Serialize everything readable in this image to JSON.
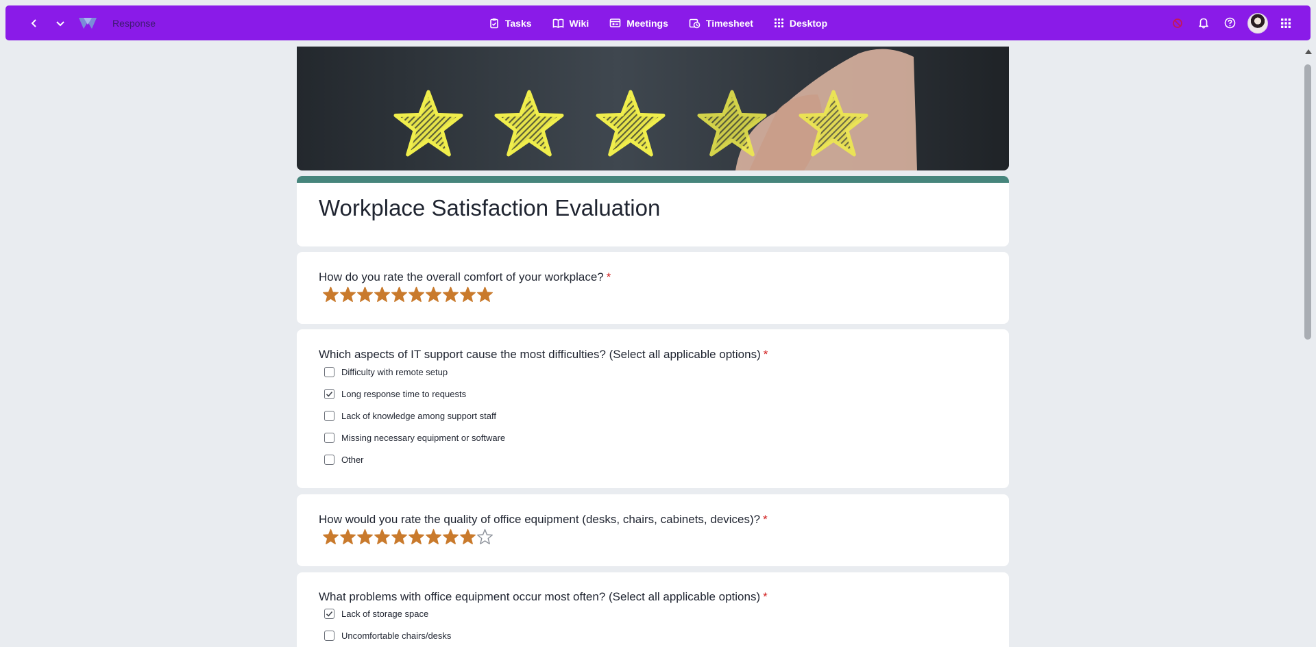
{
  "header": {
    "app_name": "Response",
    "nav": [
      {
        "label": "Tasks",
        "icon": "clipboard-icon"
      },
      {
        "label": "Wiki",
        "icon": "book-icon"
      },
      {
        "label": "Meetings",
        "icon": "meetings-icon"
      },
      {
        "label": "Timesheet",
        "icon": "timesheet-icon"
      },
      {
        "label": "Desktop",
        "icon": "grid-icon"
      }
    ],
    "colors": {
      "bar": "#8a1be8",
      "status": "#c2185b"
    }
  },
  "form": {
    "title": "Workplace Satisfaction Evaluation",
    "accent_color": "#46857c",
    "star_color": "#c97a2c",
    "questions": [
      {
        "type": "rating",
        "text": "How do you rate the overall comfort of your workplace?",
        "required_mark": "*",
        "max": 10,
        "value": 10
      },
      {
        "type": "checkbox",
        "text": "Which aspects of IT support cause the most difficulties? (Select all applicable options)",
        "required_mark": "*",
        "options": [
          {
            "label": "Difficulty with remote setup",
            "checked": false
          },
          {
            "label": "Long response time to requests",
            "checked": true
          },
          {
            "label": "Lack of knowledge among support staff",
            "checked": false
          },
          {
            "label": "Missing necessary equipment or software",
            "checked": false
          },
          {
            "label": "Other",
            "checked": false
          }
        ]
      },
      {
        "type": "rating",
        "text": "How would you rate the quality of office equipment (desks, chairs, cabinets, devices)?",
        "required_mark": "*",
        "max": 10,
        "value": 9
      },
      {
        "type": "checkbox",
        "text": "What problems with office equipment occur most often? (Select all applicable options)",
        "required_mark": "*",
        "options": [
          {
            "label": "Lack of storage space",
            "checked": true
          },
          {
            "label": "Uncomfortable chairs/desks",
            "checked": false
          }
        ]
      }
    ]
  }
}
